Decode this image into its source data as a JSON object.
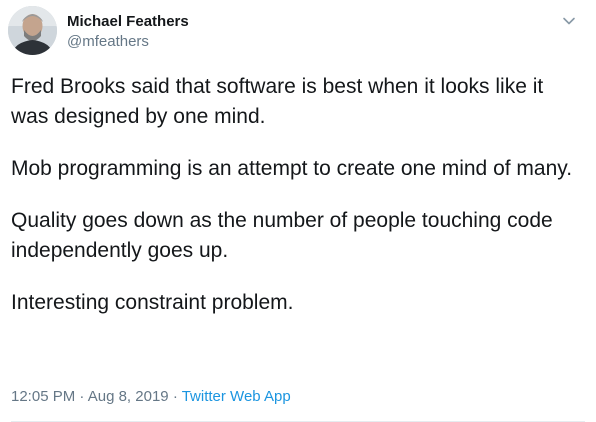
{
  "author": {
    "display_name": "Michael Feathers",
    "handle": "@mfeathers"
  },
  "menu_icon": "chevron-down-icon",
  "tweet": {
    "paragraphs": [
      "Fred Brooks said that software is best when it looks like it was designed by one mind.",
      "Mob programming is an attempt to create one mind of many.",
      "Quality goes down as the number of people touching code independently goes up.",
      "Interesting constraint problem."
    ]
  },
  "meta": {
    "time": "12:05 PM",
    "separator": "·",
    "date": "Aug 8, 2019",
    "source": "Twitter Web App"
  },
  "colors": {
    "text": "#14171a",
    "secondary": "#657786",
    "link": "#1b95e0"
  }
}
